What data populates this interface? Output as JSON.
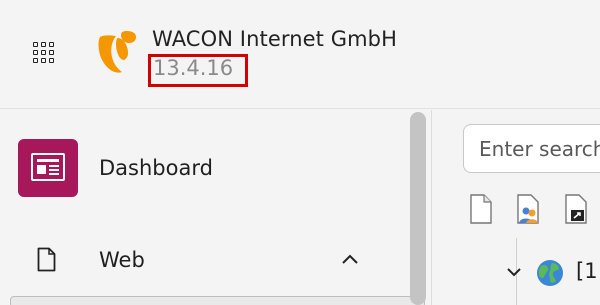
{
  "header": {
    "site_name": "WACON Internet GmbH",
    "version": "13.4.16",
    "brand_color": "#f49700",
    "highlight_color": "#d20000"
  },
  "sidebar": {
    "items": [
      {
        "label": "Dashboard",
        "icon": "dashboard-icon",
        "icon_bg": "#a7185a"
      },
      {
        "label": "Web",
        "icon": "file-icon",
        "expanded": true
      }
    ]
  },
  "page_tree": {
    "search_placeholder": "Enter search term",
    "toolbar_icons": [
      "new-page-icon",
      "page-user-icon",
      "page-shortcut-icon"
    ],
    "root_node_label": "[1"
  }
}
